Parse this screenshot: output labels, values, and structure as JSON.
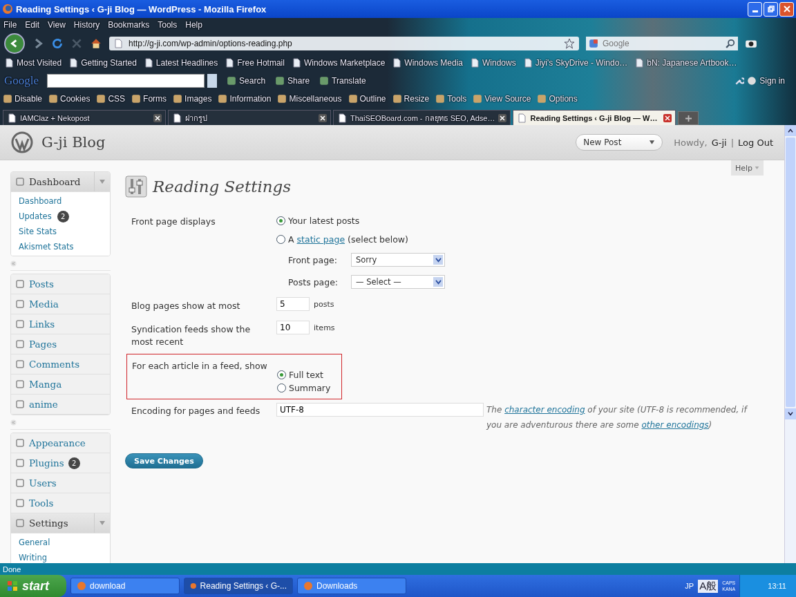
{
  "window": {
    "title": "Reading Settings ‹ G-ji Blog — WordPress - Mozilla Firefox"
  },
  "menu_bar": [
    "File",
    "Edit",
    "View",
    "History",
    "Bookmarks",
    "Tools",
    "Help"
  ],
  "navigation": {
    "url": "http://g-ji.com/wp-admin/options-reading.php",
    "search_placeholder": "Google"
  },
  "bookmarks": [
    "Most Visited",
    "Getting Started",
    "Latest Headlines",
    "Free Hotmail",
    "Windows Marketplace",
    "Windows Media",
    "Windows",
    "Jiyi's SkyDrive - Windo…",
    "bN: Japanese Artbook…"
  ],
  "google_toolbar": {
    "logo": "Google",
    "items": [
      "Search",
      "Share",
      "Translate"
    ],
    "sign_in": "Sign in"
  },
  "developer_toolbar": [
    "Disable",
    "Cookies",
    "CSS",
    "Forms",
    "Images",
    "Information",
    "Miscellaneous",
    "Outline",
    "Resize",
    "Tools",
    "View Source",
    "Options"
  ],
  "tabs": [
    {
      "label": "IAMClaz + Nekopost",
      "selected": false
    },
    {
      "label": "ฝากรูป",
      "selected": false
    },
    {
      "label": "ThaiSEOBoard.com - กลยุทธ SEO, Adse…",
      "selected": false
    },
    {
      "label": "Reading Settings ‹ G-ji Blog — W…",
      "selected": true
    }
  ],
  "header": {
    "site": "G-ji Blog",
    "new_post": "New Post",
    "howdy": "Howdy,",
    "user": "G-ji",
    "separator": "|",
    "logout": "Log Out",
    "help": "Help"
  },
  "sidebar": {
    "sections": [
      {
        "items": [
          {
            "label": "Dashboard",
            "expanded": true,
            "children": [
              {
                "label": "Dashboard"
              },
              {
                "label": "Updates",
                "count": "2"
              },
              {
                "label": "Site Stats"
              },
              {
                "label": "Akismet Stats"
              }
            ]
          }
        ]
      },
      {
        "items": [
          {
            "label": "Posts",
            "expanded": false
          },
          {
            "label": "Media",
            "expanded": false
          },
          {
            "label": "Links",
            "expanded": false
          },
          {
            "label": "Pages",
            "expanded": false
          },
          {
            "label": "Comments",
            "expanded": false
          },
          {
            "label": "Manga",
            "expanded": false
          },
          {
            "label": "anime",
            "expanded": false
          }
        ]
      },
      {
        "items": [
          {
            "label": "Appearance",
            "expanded": false
          },
          {
            "label": "Plugins",
            "expanded": false,
            "count": "2"
          },
          {
            "label": "Users",
            "expanded": false
          },
          {
            "label": "Tools",
            "expanded": false
          },
          {
            "label": "Settings",
            "expanded": true,
            "children": [
              {
                "label": "General"
              },
              {
                "label": "Writing"
              }
            ]
          }
        ]
      }
    ]
  },
  "page_title": "Reading Settings",
  "rows": [
    {
      "kind": "front",
      "label": "Front page displays",
      "highlighted": false,
      "options": [
        {
          "label": "Your latest posts",
          "selected": true
        },
        {
          "before": "A",
          "link": "static page",
          "after": "(select below)",
          "selected": false
        }
      ],
      "selects": [
        {
          "label": "Front page:",
          "value": "Sorry"
        },
        {
          "label": "Posts page:",
          "value": "— Select —"
        }
      ]
    },
    {
      "kind": "number",
      "label": "Blog pages show at most",
      "highlighted": false,
      "value": "5",
      "unit": "posts"
    },
    {
      "kind": "number",
      "label": "Syndication feeds show the most recent",
      "highlighted": false,
      "value": "10",
      "unit": "items"
    },
    {
      "kind": "radios",
      "label": "For each article in a feed, show",
      "highlighted": true,
      "options": [
        {
          "label": "Full text",
          "selected": true
        },
        {
          "label": "Summary",
          "selected": false
        }
      ]
    },
    {
      "kind": "text",
      "label": "Encoding for pages and feeds",
      "highlighted": false,
      "value": "UTF-8",
      "description": [
        {
          "text": "The "
        },
        {
          "link": "character encoding"
        },
        {
          "text": " of your site (UTF-8 is recommended, if you are adventurous there are some "
        },
        {
          "link": "other encodings"
        },
        {
          "text": ")"
        }
      ]
    }
  ],
  "save_button": "Save Changes",
  "status_bar": "Done",
  "taskbar": {
    "start": "start",
    "tasks": [
      {
        "label": "download",
        "selected": false
      },
      {
        "label": "Reading Settings ‹ G-...",
        "selected": true
      },
      {
        "label": "Downloads",
        "selected": false
      }
    ],
    "language": "JP",
    "ime": "A般",
    "caps": "CAPS",
    "kana": "KANA",
    "clock": "13:11"
  }
}
